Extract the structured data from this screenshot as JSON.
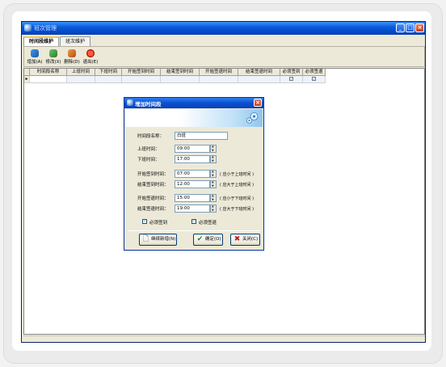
{
  "window": {
    "title": "班次管理",
    "min_glyph": "_",
    "max_glyph": "□",
    "close_glyph": "×"
  },
  "tabs": [
    {
      "label": "时间段维护",
      "active": true
    },
    {
      "label": "班次维护",
      "active": false
    }
  ],
  "toolbar": {
    "add_label": "增加(A)",
    "edit_label": "修改(X)",
    "delete_label": "删除(D)",
    "exit_label": "退出(E)"
  },
  "grid": {
    "row_indicator": "▸",
    "columns": [
      "时间段名称",
      "上班时间",
      "下班时间",
      "开始签到时间",
      "结束签到时间",
      "开始签退时间",
      "结束签退时间",
      "必须签到",
      "必须签退"
    ],
    "row_checks": [
      "✓",
      "✓"
    ]
  },
  "dialog": {
    "title": "增加时间段",
    "close_glyph": "×",
    "fields": {
      "name_label": "时间段名称：",
      "name_value": "白班",
      "on_label": "上班时间：",
      "on_value": "09:00",
      "off_label": "下班时间：",
      "off_value": "17:00",
      "checkin_start_label": "开始签到时间：",
      "checkin_start_value": "07:00",
      "checkin_end_label": "结束签到时间：",
      "checkin_end_value": "12:00",
      "checkout_start_label": "开始签退时间：",
      "checkout_start_value": "15:00",
      "checkout_end_label": "结束签退时间：",
      "checkout_end_value": "19:00"
    },
    "hints": {
      "checkin_start": "( 应小于上班时间 )",
      "checkin_end": "( 应大于上班时间 )",
      "checkout_start": "( 应小于下班时间 )",
      "checkout_end": "( 应大于下班时间 )"
    },
    "checkboxes": {
      "must_checkin_label": "必须签到",
      "must_checkin_checked": true,
      "must_checkout_label": "必须签退",
      "must_checkout_checked": true,
      "check_glyph": "✓"
    },
    "buttons": {
      "continue_label": "继续新增(N)",
      "ok_label": "确定(O)",
      "close_label": "关闭(C)",
      "continue_icon": "🗋",
      "ok_icon": "✔",
      "close_icon": "✖"
    }
  }
}
